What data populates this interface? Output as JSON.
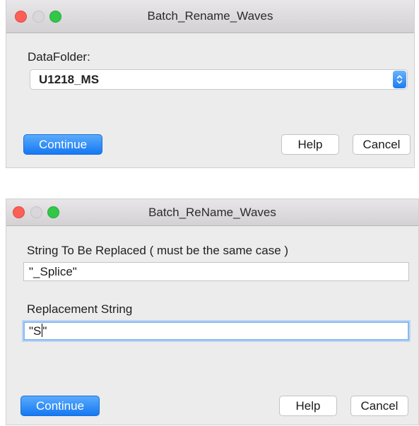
{
  "dialog1": {
    "title": "Batch_Rename_Waves",
    "folder_label": "DataFolder:",
    "folder_value": "U1218_MS",
    "continue_label": "Continue",
    "help_label": "Help",
    "cancel_label": "Cancel"
  },
  "dialog2": {
    "title": "Batch_ReName_Waves",
    "replace_label": "String To Be Replaced ( must be the same case )",
    "replace_value": "\"_Splice\"",
    "replacement_label": "Replacement String",
    "replacement_value_before_caret": "\"S",
    "replacement_value_after_caret": "\"",
    "continue_label": "Continue",
    "help_label": "Help",
    "cancel_label": "Cancel"
  },
  "icons": {
    "stepper": "up-down-chevron-icon",
    "close": "close-traffic-light-icon",
    "minimize": "minimize-traffic-light-icon",
    "zoom": "zoom-traffic-light-icon"
  },
  "colors": {
    "accent": "#1b7cf2",
    "close_light": "#fc5f57",
    "zoom_light": "#32c748",
    "disabled_light": "#d9d7d9"
  }
}
